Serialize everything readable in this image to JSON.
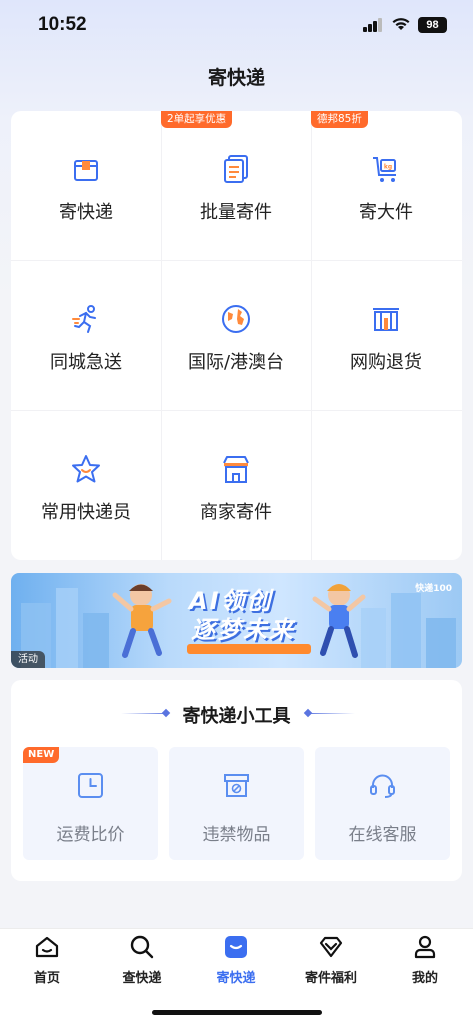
{
  "status": {
    "time": "10:52",
    "battery": "98"
  },
  "header": {
    "title": "寄快递"
  },
  "services": {
    "badges": {
      "batch": "2单起享优惠",
      "large": "德邦85折"
    },
    "items": [
      {
        "label": "寄快递",
        "icon": "package-icon"
      },
      {
        "label": "批量寄件",
        "icon": "documents-icon"
      },
      {
        "label": "寄大件",
        "icon": "cart-kg-icon"
      },
      {
        "label": "同城急送",
        "icon": "runner-icon"
      },
      {
        "label": "国际/港澳台",
        "icon": "globe-icon"
      },
      {
        "label": "网购退货",
        "icon": "return-box-icon"
      },
      {
        "label": "常用快递员",
        "icon": "star-icon"
      },
      {
        "label": "商家寄件",
        "icon": "store-icon"
      }
    ]
  },
  "banner": {
    "title_line1": "AI领创",
    "title_line2": "逐梦未来",
    "brand": "快递100",
    "tag": "活动"
  },
  "tools": {
    "title": "寄快递小工具",
    "new_badge": "NEW",
    "items": [
      {
        "label": "运费比价",
        "icon": "clock-icon"
      },
      {
        "label": "违禁物品",
        "icon": "prohibited-box-icon"
      },
      {
        "label": "在线客服",
        "icon": "headset-icon"
      }
    ]
  },
  "tabbar": {
    "items": [
      {
        "label": "首页",
        "icon": "home-icon"
      },
      {
        "label": "查快递",
        "icon": "search-icon"
      },
      {
        "label": "寄快递",
        "icon": "send-package-icon",
        "active": true
      },
      {
        "label": "寄件福利",
        "icon": "diamond-icon"
      },
      {
        "label": "我的",
        "icon": "user-icon"
      }
    ]
  },
  "colors": {
    "accent": "#3b6ef0",
    "promo": "#ff6a2b"
  }
}
